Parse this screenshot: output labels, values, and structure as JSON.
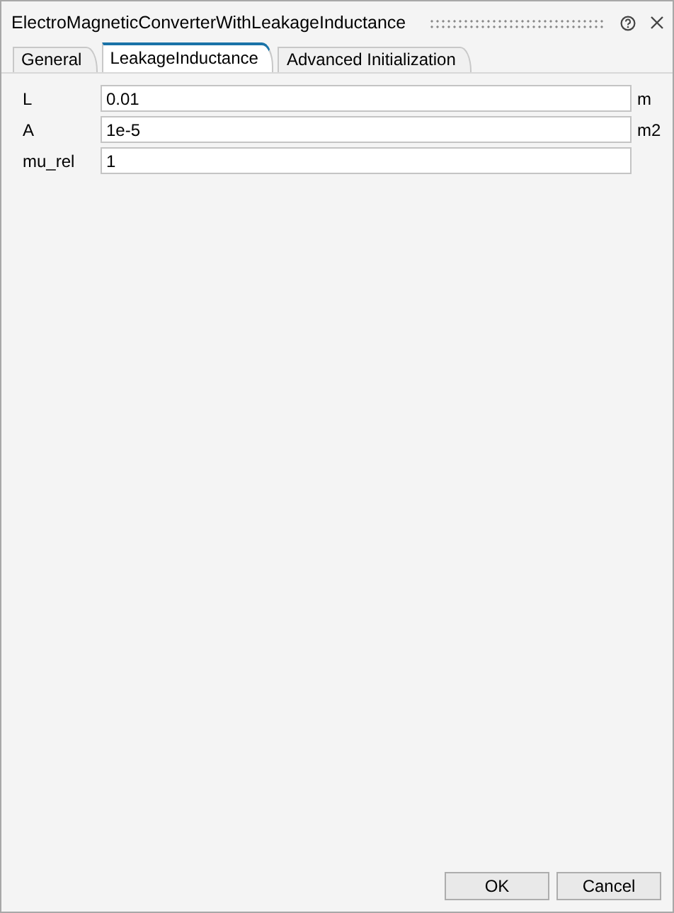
{
  "window": {
    "title": "ElectroMagneticConverterWithLeakageInductance"
  },
  "tabs": [
    {
      "label": "General",
      "selected": false
    },
    {
      "label": "LeakageInductance",
      "selected": true
    },
    {
      "label": "Advanced Initialization",
      "selected": false
    }
  ],
  "parameters": [
    {
      "name": "L",
      "value": "0.01",
      "unit": "m"
    },
    {
      "name": "A",
      "value": "1e-5",
      "unit": "m2"
    },
    {
      "name": "mu_rel",
      "value": "1"
    }
  ],
  "buttons": [
    "OK",
    "Cancel"
  ]
}
